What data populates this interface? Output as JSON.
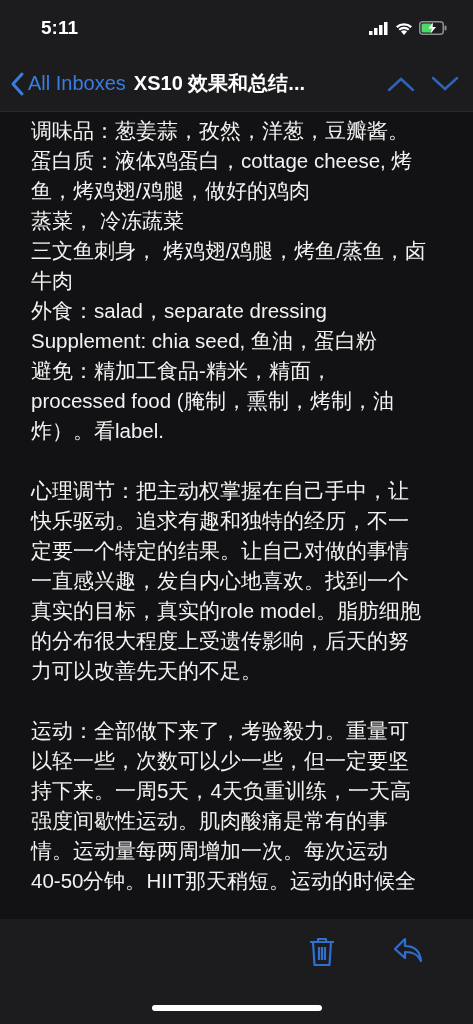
{
  "status_bar": {
    "time": "5:11"
  },
  "nav": {
    "back_label": "All Inboxes",
    "title": "XS10 效果和总结..."
  },
  "body": {
    "paragraphs": [
      {
        "lines": [
          "调味品：葱姜蒜，孜然，洋葱，豆瓣酱。",
          "蛋白质：液体鸡蛋白，cottage cheese, 烤",
          "鱼，烤鸡翅/鸡腿，做好的鸡肉",
          "蒸菜， 冷冻蔬菜",
          "三文鱼刺身， 烤鸡翅/鸡腿，烤鱼/蒸鱼，卤",
          "牛肉",
          "外食：salad，separate dressing",
          "Supplement: chia seed, 鱼油，蛋白粉",
          "避免：精加工食品-精米，精面，",
          "processed food (腌制，熏制，烤制，油",
          "炸）。看label."
        ]
      },
      {
        "lines": [
          "心理调节：把主动权掌握在自己手中，让",
          "快乐驱动。追求有趣和独特的经历，不一",
          "定要一个特定的结果。让自己对做的事情",
          "一直感兴趣，发自内心地喜欢。找到一个",
          "真实的目标，真实的role model。脂肪细胞",
          "的分布很大程度上受遗传影响，后天的努",
          "力可以改善先天的不足。"
        ]
      },
      {
        "lines": [
          "运动：全部做下来了，考验毅力。重量可",
          "以轻一些，次数可以少一些，但一定要坚",
          "持下来。一周5天，4天负重训练，一天高",
          "强度间歇性运动。肌肉酸痛是常有的事",
          "情。运动量每两周增加一次。每次运动",
          "40-50分钟。HIIT那天稍短。运动的时候全"
        ]
      }
    ]
  }
}
